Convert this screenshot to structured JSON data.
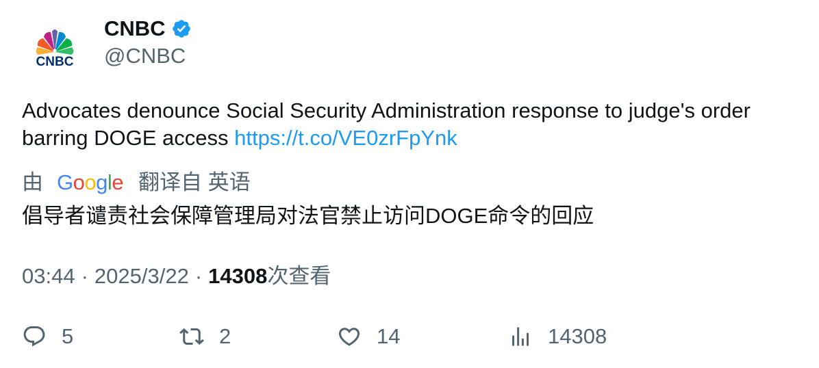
{
  "account": {
    "display_name": "CNBC",
    "handle": "@CNBC",
    "logo_text": "CNBC",
    "verified": true
  },
  "tweet": {
    "text": "Advocates denounce Social Security Administration response to judge's order barring DOGE access ",
    "link": "https://t.co/VE0zrFpYnk"
  },
  "translation": {
    "prefix": "由",
    "provider": "Google",
    "suffix": "翻译自 英语",
    "text": "倡导者谴责社会保障管理局对法官禁止访问DOGE命令的回应"
  },
  "meta": {
    "time": "03:44",
    "separator": "·",
    "date": "2025/3/22",
    "views": "14308",
    "views_label": "次查看"
  },
  "actions": {
    "replies": "5",
    "retweets": "2",
    "likes": "14",
    "views": "14308"
  },
  "colors": {
    "link": "#1d9bf0",
    "secondary_text": "#536471",
    "primary_text": "#0f1419",
    "verified_badge": "#1d9bf0"
  }
}
